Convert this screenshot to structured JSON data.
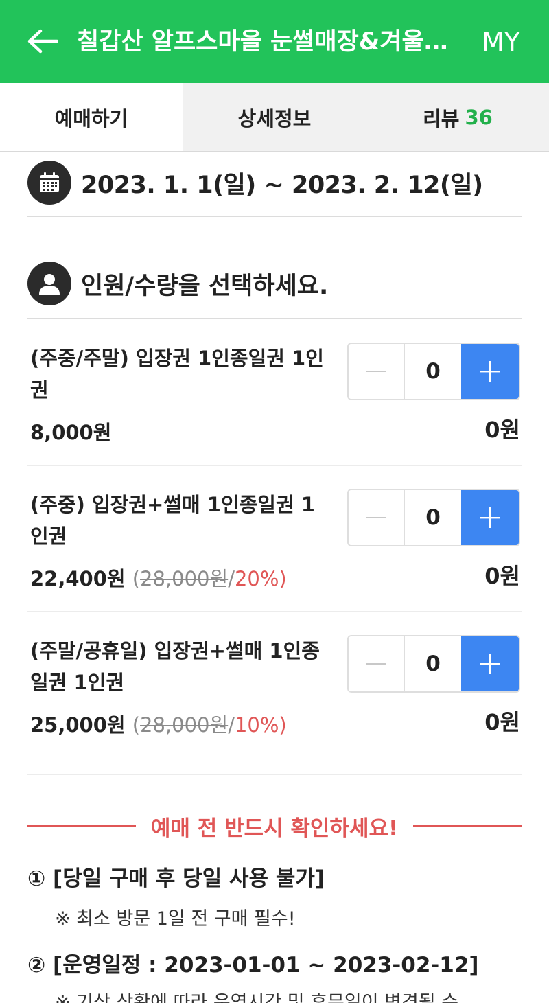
{
  "header": {
    "title": "칠갑산 알프스마을 눈썰매장&겨울축제",
    "my_label": "MY",
    "bg_color": "#22c35a"
  },
  "tabs": [
    {
      "label": "예매하기",
      "active": true
    },
    {
      "label": "상세정보",
      "active": false
    },
    {
      "label": "리뷰",
      "count": "36",
      "active": false
    }
  ],
  "date_range": "2023. 1. 1(일) ~ 2023. 2. 12(일)",
  "quantity_heading": "인원/수량을 선택하세요.",
  "items": [
    {
      "name": "(주중/주말) 입장권 1인종일권 1인권",
      "price": "8,000원",
      "quantity": "0",
      "total": "0원"
    },
    {
      "name": "(주중) 입장권+썰매 1인종일권 1인권",
      "price": "22,400원",
      "original_price": "28,000원",
      "discount": "20%",
      "quantity": "0",
      "total": "0원"
    },
    {
      "name": "(주말/공휴일) 입장권+썰매 1인종일권 1인권",
      "price": "25,000원",
      "original_price": "28,000원",
      "discount": "10%",
      "quantity": "0",
      "total": "0원"
    }
  ],
  "notice": {
    "title": "예매 전 반드시 확인하세요!",
    "items": [
      {
        "label": "① [당일 구매 후 당일 사용 불가]",
        "sub": "※ 최소 방문 1일 전 구매 필수!"
      },
      {
        "label": "② [운영일정 : 2023-01-01 ~ 2023-02-12]",
        "sub": "※ 기상 상황에 따라 운영시간 및 휴무일이 변경될 수"
      }
    ],
    "accent_color": "#e05656"
  },
  "colors": {
    "plus_button": "#3d86f2",
    "review_count": "#22b04b"
  }
}
